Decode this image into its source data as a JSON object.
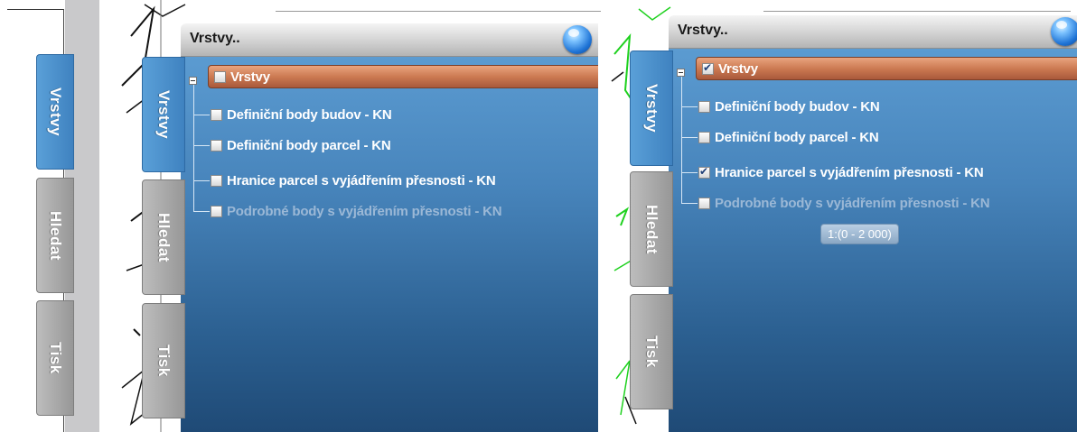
{
  "panel_collapsed": {
    "tabs": [
      "Vrstvy",
      "Hledat",
      "Tisk"
    ]
  },
  "panel_expanded_1": {
    "title": "Vrstvy..",
    "tabs": [
      "Vrstvy",
      "Hledat",
      "Tisk"
    ],
    "root": {
      "label": "Vrstvy",
      "checked": false
    },
    "layers": [
      {
        "label": "Definiční body budov - KN",
        "checked": false,
        "dimmed": false
      },
      {
        "label": "Definiční body parcel - KN",
        "checked": false,
        "dimmed": false
      },
      {
        "label": "Hranice parcel s vyjádřením přesnosti - KN",
        "checked": false,
        "dimmed": false
      },
      {
        "label": "Podrobné body s vyjádřením přesnosti - KN",
        "checked": false,
        "dimmed": true
      }
    ]
  },
  "panel_expanded_2": {
    "title": "Vrstvy..",
    "tabs": [
      "Vrstvy",
      "Hledat",
      "Tisk"
    ],
    "root": {
      "label": "Vrstvy",
      "checked": true
    },
    "layers": [
      {
        "label": "Definiční body budov - KN",
        "checked": false,
        "dimmed": false
      },
      {
        "label": "Definiční body parcel - KN",
        "checked": false,
        "dimmed": false
      },
      {
        "label": "Hranice parcel s vyjádřením přesnosti - KN",
        "checked": true,
        "dimmed": false
      },
      {
        "label": "Podrobné body s vyjádřením přesnosti - KN",
        "checked": false,
        "dimmed": true
      }
    ],
    "tooltip": "1:(0 - 2 000)"
  },
  "colors": {
    "active_tab": "#4a8cc8",
    "inactive_tab": "#a8a8a8",
    "root_row": "#c8744c",
    "panel_body_top": "#5b9bd1",
    "panel_body_bottom": "#1f4a76",
    "map_line_green": "#1fd11f"
  },
  "icons": [
    "globe-icon",
    "checkbox-icon",
    "collapse-minus-icon"
  ]
}
